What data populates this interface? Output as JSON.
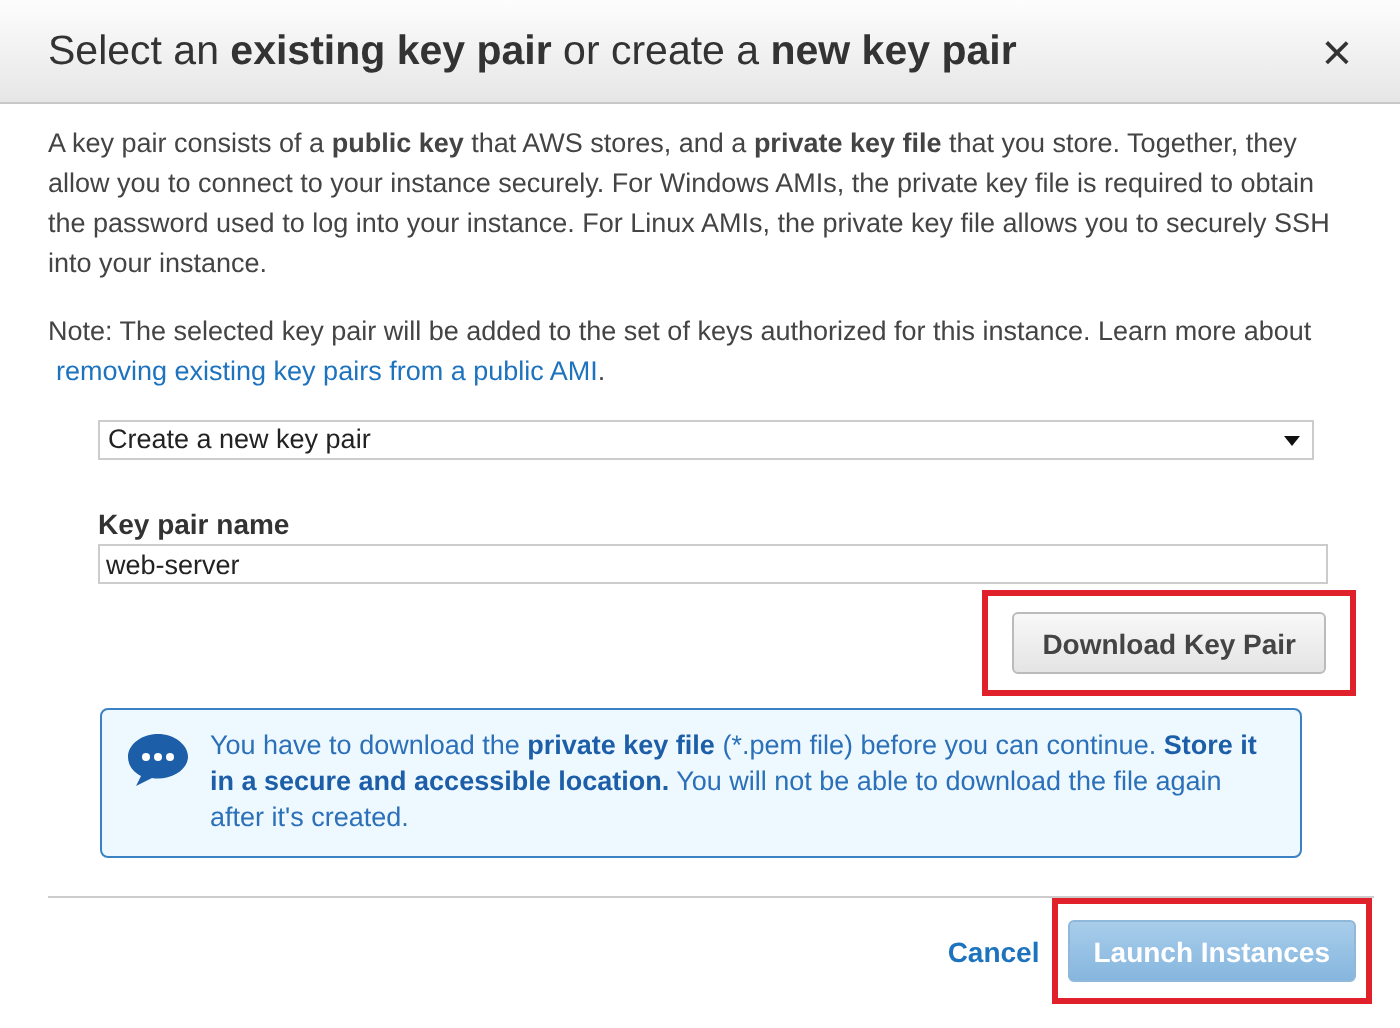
{
  "dialog": {
    "title": "Select an **existing key pair** or create a **new key pair**",
    "close": "×"
  },
  "intro": "A key pair consists of a **public key** that AWS stores, and a **private key file** that you store. Together, they allow you to connect to your instance securely. For Windows AMIs, the private key file is required to obtain the password used to log into your instance. For Linux AMIs, the private key file allows you to securely SSH into your instance.",
  "note": {
    "text": "Note: The selected key pair will be added to the set of keys authorized for this instance. Learn more about ",
    "link": "removing existing key pairs from a public AMI",
    "after": "."
  },
  "key_pair_select": {
    "value": "Create a new key pair"
  },
  "key_pair_name": {
    "label": "Key pair name",
    "value": "web-server"
  },
  "download_button": {
    "label": "Download Key Pair",
    "highlighted": true
  },
  "info": {
    "text": "You have to download the **private key file** (*.pem file) before you can continue. **Store it in a secure and accessible location.** You will not be able to download the file again after it's created."
  },
  "footer": {
    "cancel": "Cancel",
    "launch": {
      "label": "Launch Instances",
      "disabled": true,
      "highlighted": true
    }
  }
}
